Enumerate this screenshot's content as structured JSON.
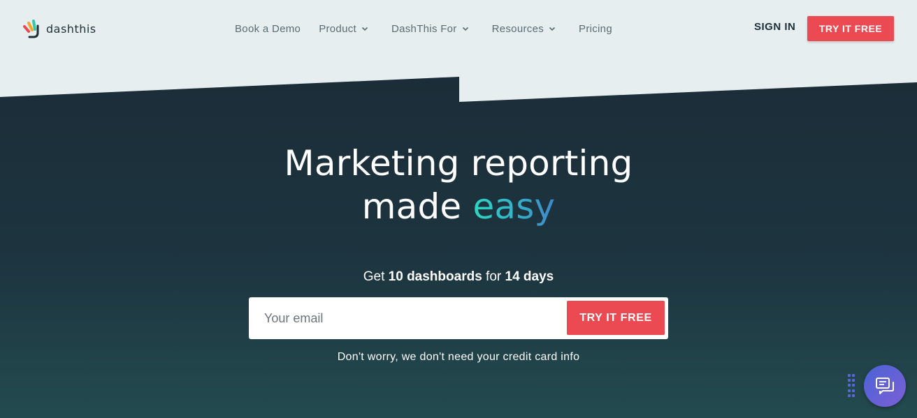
{
  "brand": {
    "name": "dashthis",
    "logo_icon": "dashthis-logo-icon"
  },
  "nav": {
    "items": [
      {
        "label": "Book a Demo",
        "has_dropdown": false
      },
      {
        "label": "Product",
        "has_dropdown": true
      },
      {
        "label": "DashThis For",
        "has_dropdown": true
      },
      {
        "label": "Resources",
        "has_dropdown": true
      },
      {
        "label": "Pricing",
        "has_dropdown": false
      }
    ],
    "sign_in": "SIGN IN",
    "cta": "TRY IT FREE"
  },
  "hero": {
    "headline_line1": "Marketing reporting",
    "headline_line2_prefix": "made ",
    "headline_highlight": "easy",
    "offer_prefix": "Get ",
    "offer_dashboards": "10 dashboards",
    "offer_middle": " for ",
    "offer_days": "14 days",
    "email_placeholder": "Your email",
    "email_value": "",
    "form_cta": "TRY IT FREE",
    "disclaimer": "Don't worry, we don't need your credit card info"
  },
  "chat": {
    "icon": "chat-bubbles-icon"
  },
  "colors": {
    "accent": "#ec4a52",
    "header_bg": "#e6eef0",
    "hero_top": "#1b2d38",
    "hero_bottom": "#234b4f",
    "highlight_start": "#2dd6c0",
    "highlight_end": "#3f87c9",
    "chat": "#5a67d8"
  }
}
